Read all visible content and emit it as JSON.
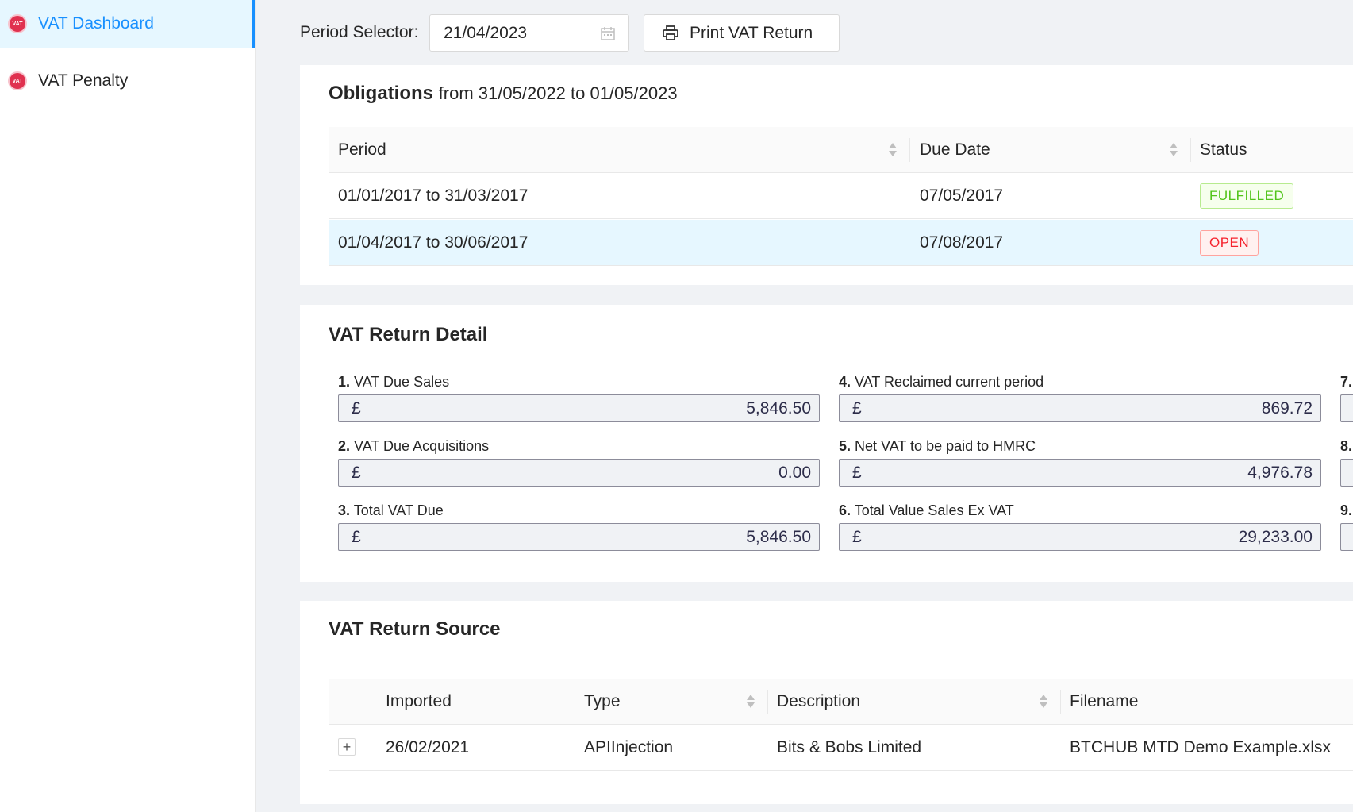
{
  "sidebar": {
    "items": [
      {
        "icon": "vat-icon",
        "icon_text": "VAT",
        "label": "VAT Dashboard",
        "active": true
      },
      {
        "icon": "vat-icon",
        "icon_text": "VAT",
        "label": "VAT Penalty",
        "active": false
      }
    ]
  },
  "toolbar": {
    "period_label": "Period Selector:",
    "period_value": "21/04/2023",
    "print_label": "Print VAT Return"
  },
  "obligations": {
    "title": "Obligations",
    "range": "from 31/05/2022 to 01/05/2023",
    "columns": [
      "Period",
      "Due Date",
      "Status"
    ],
    "rows": [
      {
        "period": "01/01/2017 to 31/03/2017",
        "due": "07/05/2017",
        "status": "FULFILLED"
      },
      {
        "period": "01/04/2017 to 30/06/2017",
        "due": "07/08/2017",
        "status": "OPEN"
      }
    ]
  },
  "vat_detail": {
    "title": "VAT Return Detail",
    "currency": "£",
    "fields": [
      {
        "num": "1.",
        "label": "VAT Due Sales",
        "value": "5,846.50"
      },
      {
        "num": "2.",
        "label": "VAT Due Acquisitions",
        "value": "0.00"
      },
      {
        "num": "3.",
        "label": "Total VAT Due",
        "value": "5,846.50"
      },
      {
        "num": "4.",
        "label": "VAT Reclaimed current period",
        "value": "869.72"
      },
      {
        "num": "5.",
        "label": "Net VAT to be paid to HMRC",
        "value": "4,976.78"
      },
      {
        "num": "6.",
        "label": "Total Value Sales Ex VAT",
        "value": "29,233.00"
      }
    ],
    "partial_nums": [
      "7.",
      "8.",
      "9."
    ]
  },
  "vat_source": {
    "title": "VAT Return Source",
    "columns": [
      "Imported",
      "Type",
      "Description",
      "Filename"
    ],
    "rows": [
      {
        "expand": "+",
        "imported": "26/02/2021",
        "type": "APIInjection",
        "description": "Bits & Bobs Limited",
        "filename": "BTCHUB MTD Demo Example.xlsx"
      }
    ]
  },
  "colors": {
    "accent": "#1890ff",
    "fulfilled": "#52c41a",
    "open": "#f5222d",
    "vat_icon": "#e0314f"
  }
}
